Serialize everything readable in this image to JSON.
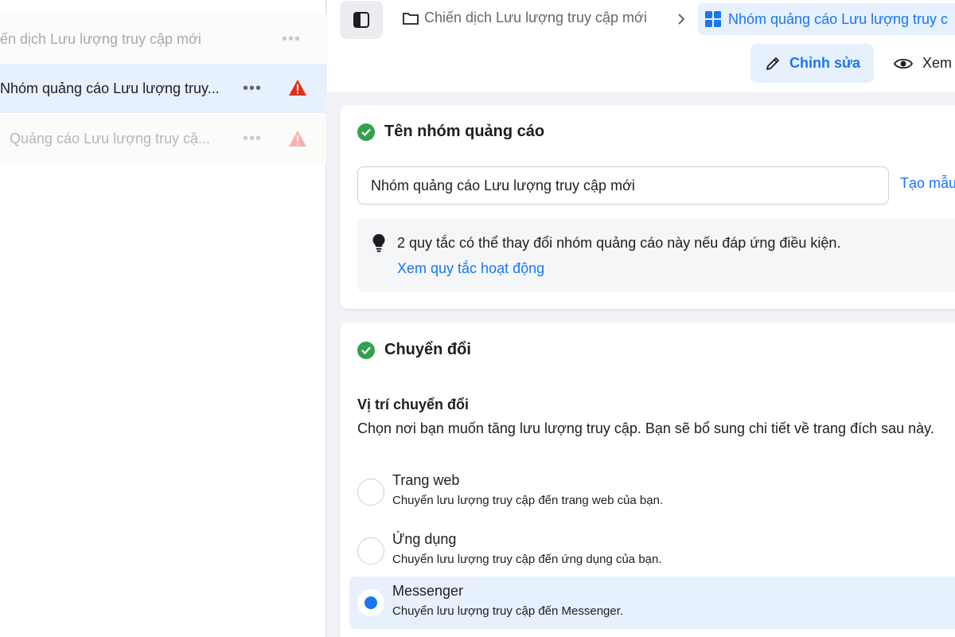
{
  "tree": {
    "campaign": {
      "label": "ến dịch Lưu lượng truy cập mới",
      "more": "•••"
    },
    "adset": {
      "label": "Nhóm quảng cáo Lưu lượng truy...",
      "more": "•••"
    },
    "ad": {
      "label": "Quảng cáo Lưu lượng truy cậ...",
      "more": "•••"
    }
  },
  "header": {
    "breadcrumb_campaign": "Chiến dịch Lưu lượng truy cập mới",
    "breadcrumb_adset": "Nhóm quảng cáo Lưu lượng truy c",
    "edit_label": "Chỉnh sửa",
    "view_label": "Xem"
  },
  "adset_name_card": {
    "title": "Tên nhóm quảng cáo",
    "name_value": "Nhóm quảng cáo Lưu lượng truy cập mới",
    "template_link": "Tạo mẫu",
    "rules_text": "2 quy tắc có thể thay đổi nhóm quảng cáo này nếu đáp ứng điều kiện.",
    "rules_link": "Xem quy tắc hoạt động"
  },
  "conversion_card": {
    "title": "Chuyển đổi",
    "location_label": "Vị trí chuyển đổi",
    "location_desc": "Chọn nơi bạn muốn tăng lưu lượng truy cập. Bạn sẽ bổ sung chi tiết về trang đích sau này.",
    "options": [
      {
        "title": "Trang web",
        "desc": "Chuyển lưu lượng truy cập đến trang web của bạn.",
        "selected": false
      },
      {
        "title": "Ứng dụng",
        "desc": "Chuyển lưu lượng truy cập đến ứng dụng của bạn.",
        "selected": false
      },
      {
        "title": "Messenger",
        "desc": "Chuyển lưu lượng truy cập đến Messenger.",
        "selected": true
      }
    ]
  },
  "colors": {
    "accent": "#1877f2",
    "selected_bg": "#e7f0fd",
    "success": "#31a24c",
    "warning": "#e0301e"
  },
  "icons": {
    "sidebar_toggle": "sidebar-toggle-icon",
    "folder": "folder-icon",
    "chevron": "chevron-right-icon",
    "adset": "grid-icon",
    "edit": "pencil-icon",
    "view": "eye-icon",
    "check": "check-circle-icon",
    "bulb": "lightbulb-icon",
    "warning": "warning-triangle-icon"
  }
}
